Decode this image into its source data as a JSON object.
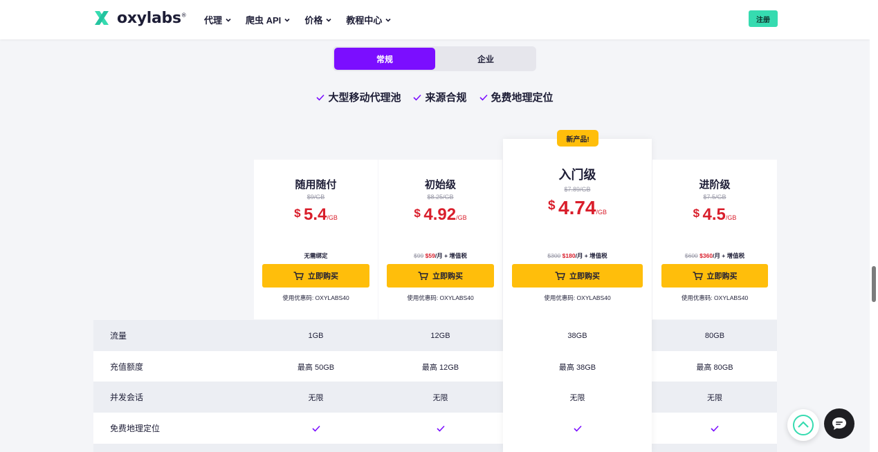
{
  "brand": {
    "name": "oxylabs",
    "registered": "®",
    "accent": "#7b0eff",
    "mint": "#36dbb0",
    "yellow": "#ffbe0b",
    "price_red": "#d91e2b"
  },
  "nav": [
    {
      "label": "代理"
    },
    {
      "label": "爬虫 API"
    },
    {
      "label": "价格"
    },
    {
      "label": "教程中心"
    }
  ],
  "header": {
    "signup_label": "注册"
  },
  "toggle": {
    "regular": "常规",
    "enterprise": "企业"
  },
  "features": [
    "大型移动代理池",
    "来源合规",
    "免费地理定位"
  ],
  "badge": "新产品!",
  "plans": [
    {
      "name": "随用随付",
      "old_price": "$9/GB",
      "currency": "$",
      "price": "5.4",
      "unit": "/GB",
      "terms_plain": "无需绑定",
      "buy_label": "立即购买",
      "coupon": "使用优惠码: OXYLABS40"
    },
    {
      "name": "初始级",
      "old_price": "$8.25/GB",
      "currency": "$",
      "price": "4.92",
      "unit": "/GB",
      "terms_old": "$99",
      "terms_new": "$59",
      "terms_suffix": "/月 + 增值税",
      "buy_label": "立即购买",
      "coupon": "使用优惠码: OXYLABS40"
    },
    {
      "name": "入门级",
      "old_price": "$7.89/GB",
      "currency": "$",
      "price": "4.74",
      "unit": "/GB",
      "terms_old": "$300",
      "terms_new": "$180",
      "terms_suffix": "/月 + 增值税",
      "buy_label": "立即购买",
      "coupon": "使用优惠码: OXYLABS40"
    },
    {
      "name": "进阶级",
      "old_price": "$7.5/GB",
      "currency": "$",
      "price": "4.5",
      "unit": "/GB",
      "terms_old": "$600",
      "terms_new": "$360",
      "terms_suffix": "/月 + 增值税",
      "buy_label": "立即购买",
      "coupon": "使用优惠码: OXYLABS40"
    }
  ],
  "table": [
    {
      "label": "流量",
      "values": [
        "1GB",
        "12GB",
        "38GB",
        "80GB"
      ]
    },
    {
      "label": "充值额度",
      "values": [
        "最高 50GB",
        "最高 12GB",
        "最高 38GB",
        "最高 80GB"
      ]
    },
    {
      "label": "并发会话",
      "values": [
        "无限",
        "无限",
        "无限",
        "无限"
      ]
    },
    {
      "label": "免费地理定位",
      "values": [
        "check-icon",
        "check-icon",
        "check-icon",
        "check-icon"
      ]
    }
  ],
  "icons": {
    "scroll_top": "chevron-up-circle-icon",
    "chat": "chat-bubble-icon",
    "cart": "cart-icon",
    "check": "check-icon"
  }
}
